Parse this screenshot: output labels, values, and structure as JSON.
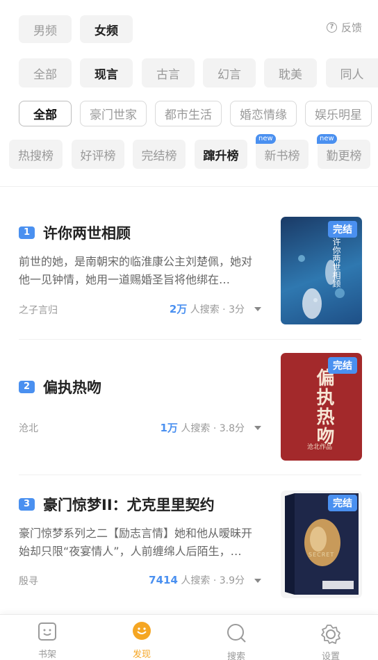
{
  "gender_tabs": [
    {
      "label": "男频",
      "active": false
    },
    {
      "label": "女频",
      "active": true
    }
  ],
  "feedback": {
    "label": "反馈"
  },
  "category_tabs": [
    {
      "label": "全部",
      "active": false
    },
    {
      "label": "现言",
      "active": true
    },
    {
      "label": "古言",
      "active": false
    },
    {
      "label": "幻言",
      "active": false
    },
    {
      "label": "耽美",
      "active": false
    },
    {
      "label": "同人",
      "active": false
    }
  ],
  "sub_tabs": [
    {
      "label": "全部",
      "active": true
    },
    {
      "label": "豪门世家",
      "active": false
    },
    {
      "label": "都市生活",
      "active": false
    },
    {
      "label": "婚恋情缘",
      "active": false
    },
    {
      "label": "娱乐明星",
      "active": false
    }
  ],
  "rank_tabs": [
    {
      "label": "热搜榜",
      "active": false,
      "new": ""
    },
    {
      "label": "好评榜",
      "active": false,
      "new": ""
    },
    {
      "label": "完结榜",
      "active": false,
      "new": ""
    },
    {
      "label": "蹿升榜",
      "active": true,
      "new": ""
    },
    {
      "label": "新书榜",
      "active": false,
      "new": "new"
    },
    {
      "label": "勤更榜",
      "active": false,
      "new": "new"
    }
  ],
  "books": [
    {
      "rank": "1",
      "title": "许你两世相顾",
      "description": "前世的她，是南朝宋的临淮康公主刘楚佩，她对他一见钟情，她用一道赐婚圣旨将他绑在…",
      "author": "之子言归",
      "search_count": "2万",
      "search_suffix": "人搜索 · 3分",
      "badge": "完结",
      "cover_text": "许你两世相顾",
      "cover_colors": [
        "#1c3f6e",
        "#3f8fc0"
      ]
    },
    {
      "rank": "2",
      "title": "偏执热吻",
      "description": "",
      "author": "沧北",
      "search_count": "1万",
      "search_suffix": "人搜索 · 3.8分",
      "badge": "完结",
      "cover_text": "偏执热吻",
      "cover_subtext": "沧北作品",
      "cover_colors": [
        "#a52a2a",
        "#8e1f22"
      ]
    },
    {
      "rank": "3",
      "title": "豪门惊梦II：尤克里里契约",
      "description": "豪门惊梦系列之二【励志言情】她和他从暧昧开始却只限“夜宴情人”，人前缠绵人后陌生，…",
      "author": "殷寻",
      "search_count": "7414",
      "search_suffix": "人搜索 · 3.9分",
      "badge": "完结",
      "cover_text": "SECRET",
      "cover_colors": [
        "#1d2647",
        "#c79a55"
      ]
    }
  ],
  "bottom_tabs": [
    {
      "label": "书架",
      "icon": "bookshelf-icon",
      "active": false
    },
    {
      "label": "发现",
      "icon": "discover-icon",
      "active": true
    },
    {
      "label": "搜索",
      "icon": "search-icon",
      "active": false
    },
    {
      "label": "设置",
      "icon": "settings-icon",
      "active": false
    }
  ],
  "colors": {
    "accent_blue": "#4a90f0",
    "accent_orange": "#f5a623",
    "chip_bg": "#f3f3f3"
  }
}
